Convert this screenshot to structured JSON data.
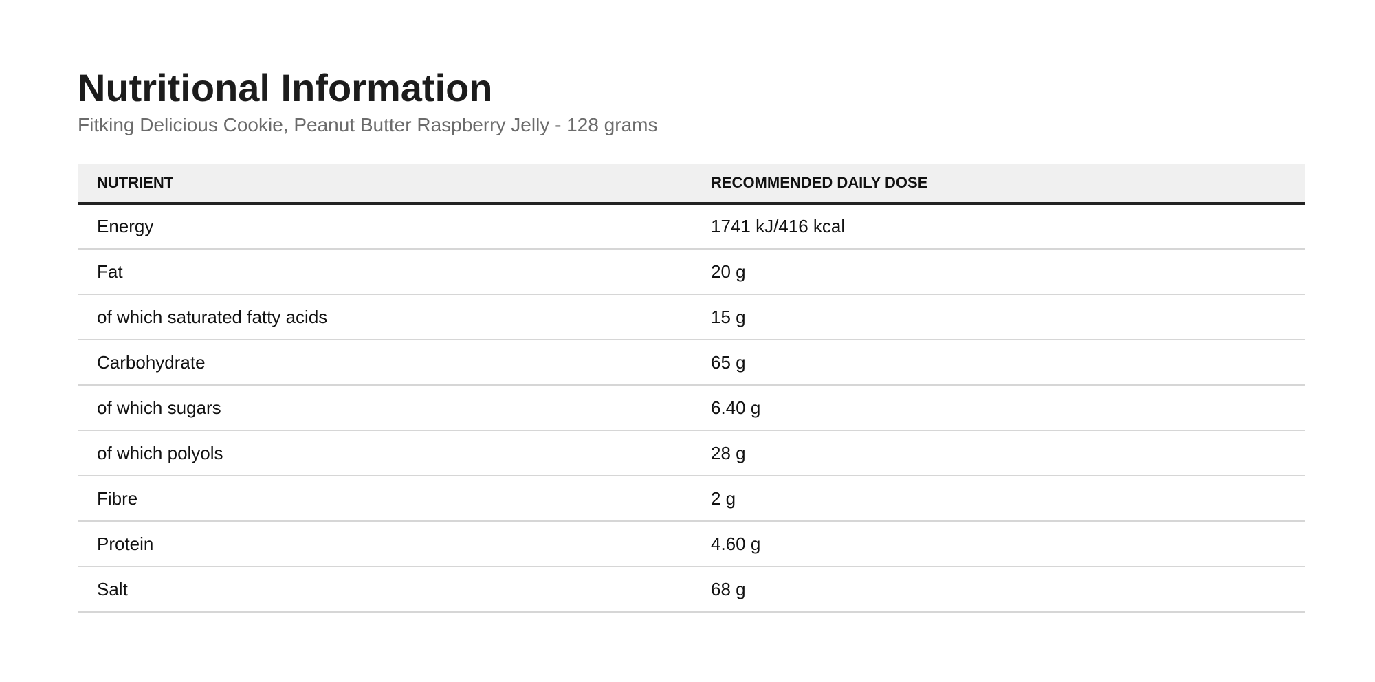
{
  "header": {
    "title": "Nutritional Information",
    "subtitle": "Fitking Delicious Cookie, Peanut Butter Raspberry Jelly - 128 grams"
  },
  "table": {
    "columns": [
      "NUTRIENT",
      "RECOMMENDED DAILY DOSE"
    ],
    "rows": [
      {
        "nutrient": "Energy",
        "dose": "1741 kJ/416 kcal"
      },
      {
        "nutrient": "Fat",
        "dose": "20 g"
      },
      {
        "nutrient": "of which saturated fatty acids",
        "dose": "15 g"
      },
      {
        "nutrient": "Carbohydrate",
        "dose": "65 g"
      },
      {
        "nutrient": "of which sugars",
        "dose": "6.40 g"
      },
      {
        "nutrient": "of which polyols",
        "dose": "28 g"
      },
      {
        "nutrient": "Fibre",
        "dose": "2 g"
      },
      {
        "nutrient": "Protein",
        "dose": "4.60 g"
      },
      {
        "nutrient": "Salt",
        "dose": "68 g"
      }
    ]
  }
}
